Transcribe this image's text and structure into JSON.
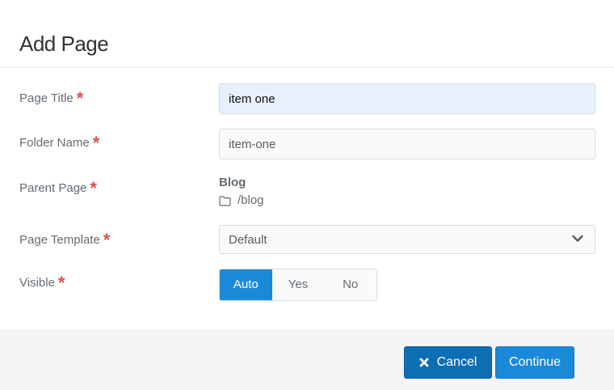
{
  "modal": {
    "title": "Add Page"
  },
  "fields": {
    "page_title": {
      "label": "Page Title",
      "required_mark": "*",
      "value": "item one"
    },
    "folder_name": {
      "label": "Folder Name",
      "required_mark": "*",
      "value": "item-one"
    },
    "parent_page": {
      "label": "Parent Page",
      "required_mark": "*",
      "name": "Blog",
      "path": "/blog",
      "path_icon": "folder-icon"
    },
    "page_template": {
      "label": "Page Template",
      "required_mark": "*",
      "selected": "Default",
      "dropdown_icon": "chevron-down-icon"
    },
    "visible": {
      "label": "Visible",
      "required_mark": "*",
      "options": [
        "Auto",
        "Yes",
        "No"
      ],
      "selected": "Auto"
    }
  },
  "footer": {
    "cancel_label": "Cancel",
    "cancel_icon": "close-icon",
    "continue_label": "Continue"
  },
  "colors": {
    "accent": "#1a8ad8",
    "cancel": "#0e6eb3",
    "required": "#d9534f",
    "autofill": "#e8f0fe",
    "footer_bg": "#f4f5f7"
  }
}
